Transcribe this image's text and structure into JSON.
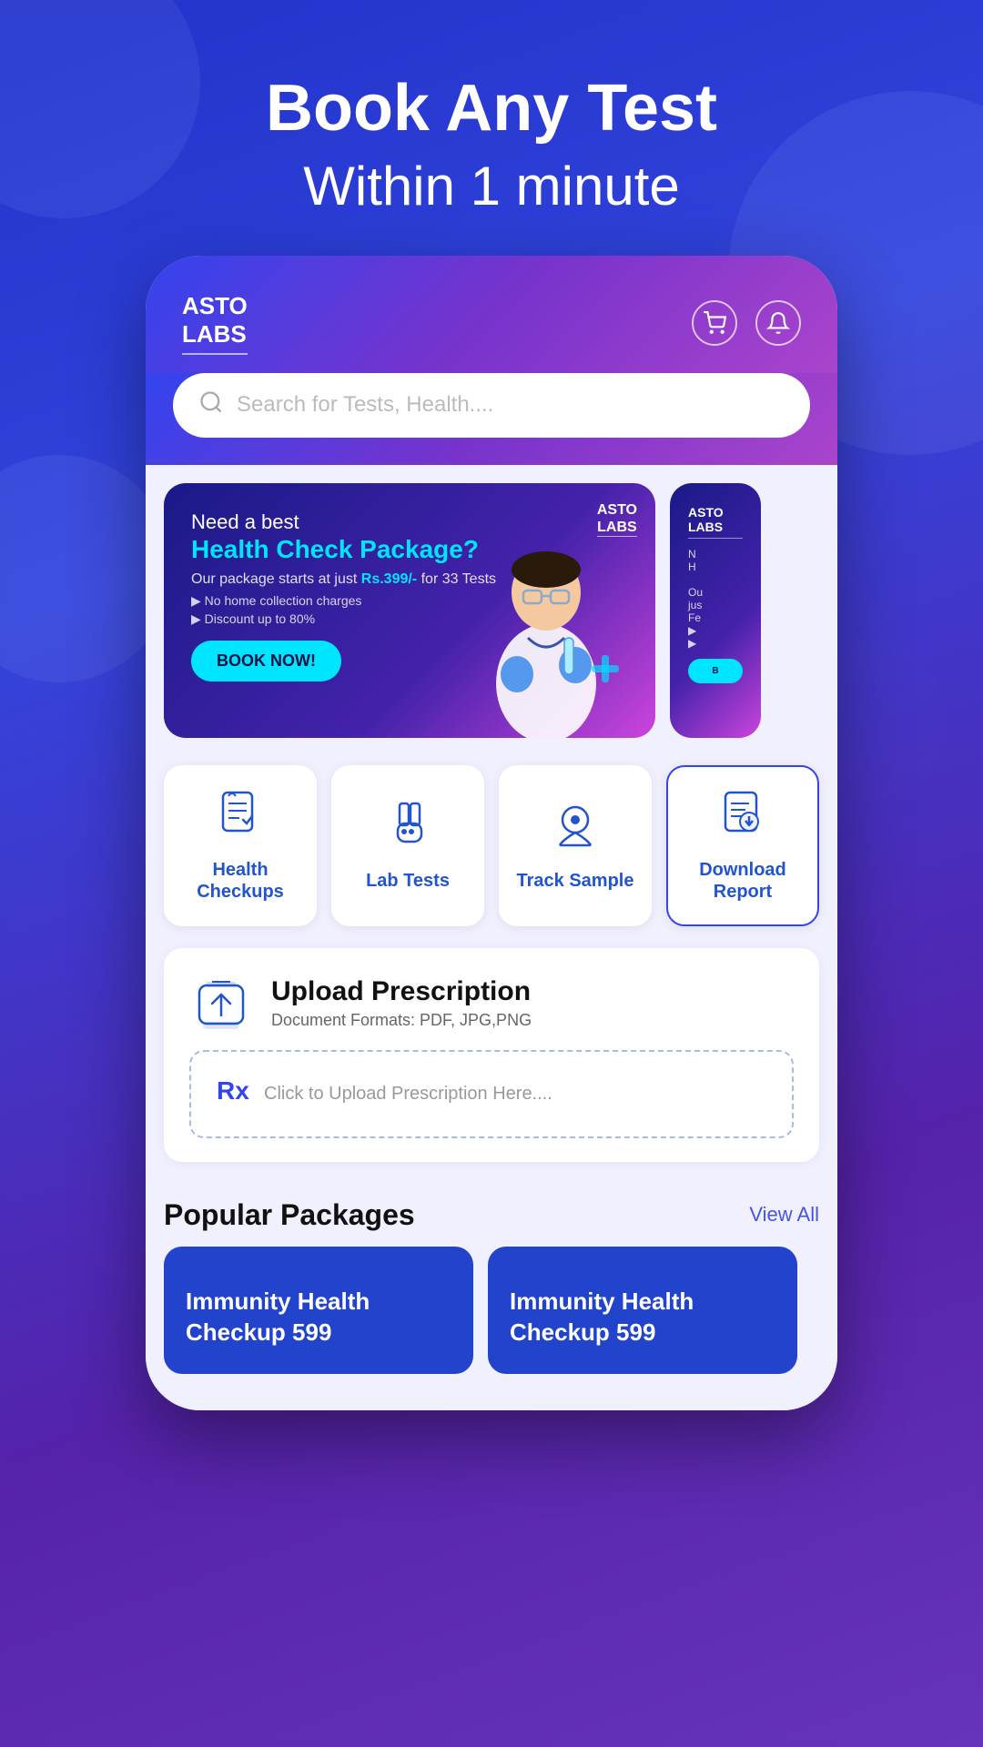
{
  "hero": {
    "title": "Book Any Test",
    "subtitle": "Within 1 minute"
  },
  "header": {
    "logo_line1": "ASTO",
    "logo_line2": "LABS",
    "cart_icon": "🛒",
    "bell_icon": "🔔"
  },
  "search": {
    "placeholder": "Search for Tests, Health...."
  },
  "banner": {
    "logo_line1": "ASTO",
    "logo_line2": "LABS",
    "pre_title": "Need a best",
    "highlight_title": "Health Check Package?",
    "description": "Our package starts at just",
    "price_text": "Rs.399/-",
    "price_suffix": " for 33 Tests",
    "feature1": "▶ No home collection charges",
    "feature2": "▶ Discount up to 80%",
    "book_btn": "BOOK NOW!"
  },
  "actions": [
    {
      "id": "health-checkups",
      "label": "Health Checkups",
      "icon": "📋"
    },
    {
      "id": "lab-tests",
      "label": "Lab Tests",
      "icon": "🧪"
    },
    {
      "id": "track-sample",
      "label": "Track Sample",
      "icon": "📍"
    },
    {
      "id": "download-report",
      "label": "Download Report",
      "icon": "📥"
    }
  ],
  "upload": {
    "icon": "📁",
    "title": "Upload Prescription",
    "subtitle": "Document Formats: PDF, JPG,PNG",
    "placeholder": "Click to Upload Prescription Here...."
  },
  "popular": {
    "section_title": "Popular Packages",
    "view_all": "View All",
    "packages": [
      {
        "label": "Immunity Health Checkup 599"
      },
      {
        "label": "Immunity Health Checkup 599"
      }
    ]
  }
}
